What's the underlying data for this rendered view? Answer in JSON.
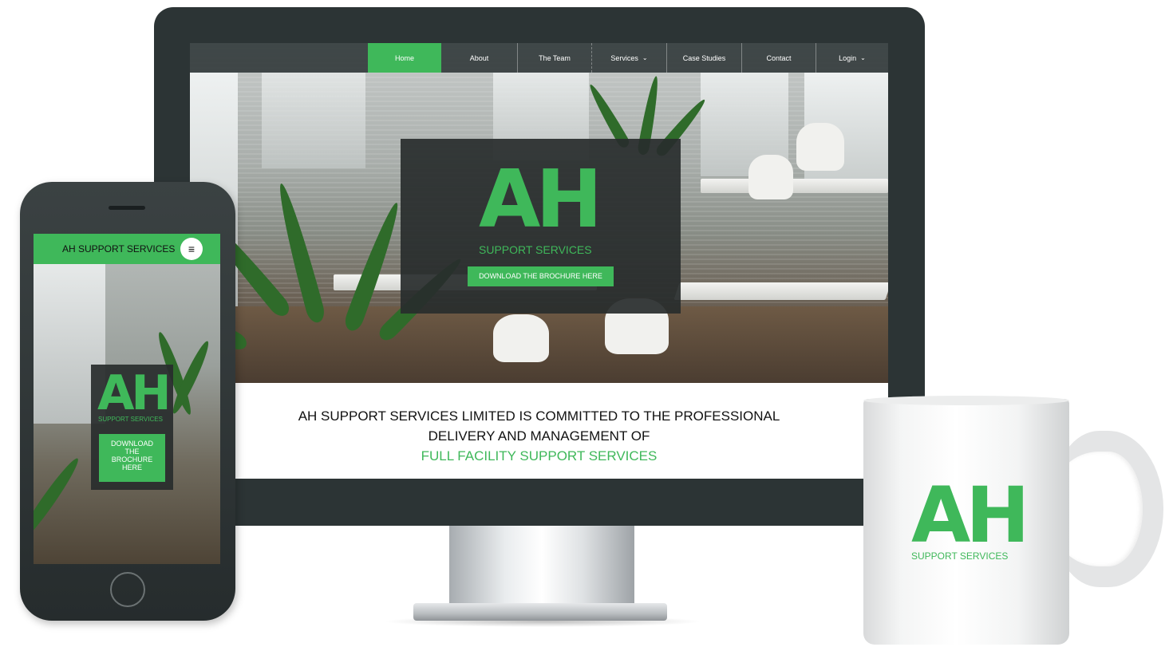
{
  "brand": {
    "logo_text": "AH",
    "logo_subtitle": "SUPPORT SERVICES",
    "accent_color": "#3fb85a",
    "dark_color": "#2c3435"
  },
  "desktop": {
    "nav": {
      "items": [
        {
          "label": "Home",
          "active": true
        },
        {
          "label": "About"
        },
        {
          "label": "The Team"
        },
        {
          "label": "Services",
          "dropdown": true
        },
        {
          "label": "Case Studies"
        },
        {
          "label": "Contact"
        },
        {
          "label": "Login",
          "dropdown": true
        }
      ],
      "chevron": "⌄"
    },
    "hero": {
      "cta_label": "DOWNLOAD THE BROCHURE HERE"
    },
    "tagline": {
      "line1": "AH SUPPORT SERVICES LIMITED IS COMMITTED TO THE PROFESSIONAL",
      "line2": "DELIVERY AND MANAGEMENT OF",
      "line3": "FULL FACILITY SUPPORT SERVICES"
    }
  },
  "mobile": {
    "header_title": "AH SUPPORT SERVICES",
    "menu_icon": "≡",
    "cta_label": "DOWNLOAD THE BROCHURE HERE"
  },
  "mug": {
    "logo_text": "AH",
    "logo_subtitle": "SUPPORT SERVICES"
  }
}
